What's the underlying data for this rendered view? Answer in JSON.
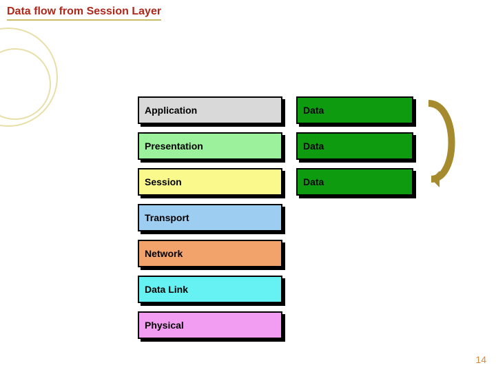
{
  "title": "Data flow from Session Layer",
  "layers": [
    {
      "name": "Application",
      "color": "#d9d9d9"
    },
    {
      "name": "Presentation",
      "color": "#9cf29c"
    },
    {
      "name": "Session",
      "color": "#f9f98c"
    },
    {
      "name": "Transport",
      "color": "#9ecdf2"
    },
    {
      "name": "Network",
      "color": "#f2a26b"
    },
    {
      "name": "Data Link",
      "color": "#66f2f2"
    },
    {
      "name": "Physical",
      "color": "#f29cf2"
    }
  ],
  "pdu_label": "Data",
  "pdu_count": 3,
  "page_number": "14"
}
